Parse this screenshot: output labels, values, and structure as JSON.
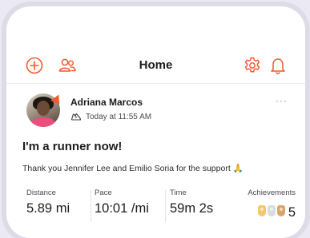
{
  "header": {
    "title": "Home",
    "left_icons": [
      "add-circle-icon",
      "people-icon"
    ],
    "right_icons": [
      "gear-icon",
      "bell-icon"
    ],
    "accent": "#f25a2b"
  },
  "post": {
    "author": "Adriana Marcos",
    "timestamp": "Today at 11:55 AM",
    "activity_icon": "running-shoe-icon",
    "more_label": "···",
    "title": "I'm a runner now!",
    "body": "Thank you Jennifer Lee and Emilio Soria for the support 🙏",
    "stats": [
      {
        "label": "Distance",
        "value": "5.89 mi"
      },
      {
        "label": "Pace",
        "value": "10:01 /mi"
      },
      {
        "label": "Time",
        "value": "59m 2s"
      }
    ],
    "achievements": {
      "label": "Achievements",
      "count": "5",
      "trophy_colors": [
        "#f2c86b",
        "#d9dbe3",
        "#d9a46b"
      ]
    }
  }
}
